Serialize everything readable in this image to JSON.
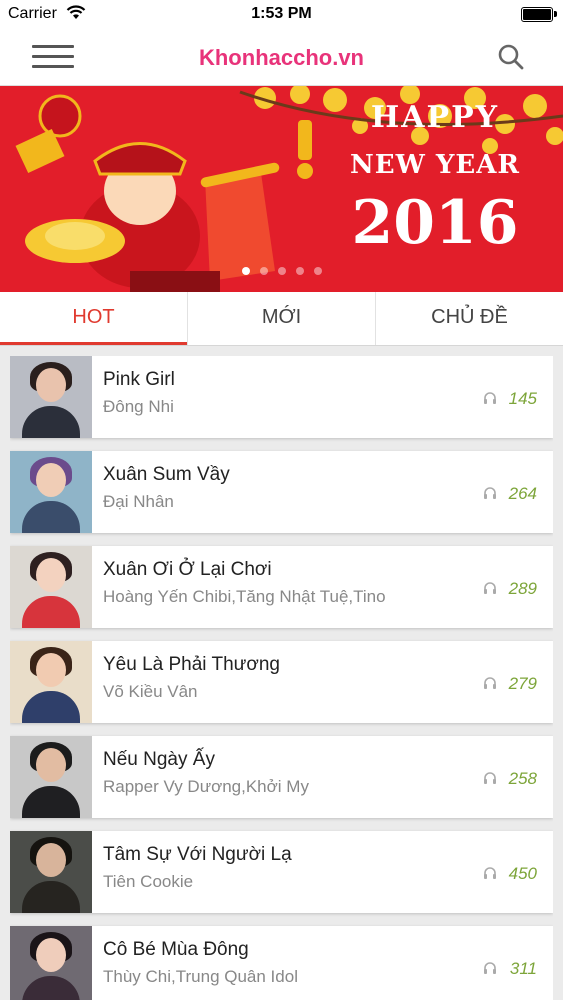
{
  "status_bar": {
    "carrier": "Carrier",
    "time": "1:53 PM"
  },
  "header": {
    "title": "Khonhaccho.vn"
  },
  "banner": {
    "line1": "HAPPY",
    "line2": "NEW YEAR",
    "line3": "2016"
  },
  "tabs": [
    {
      "label": "HOT",
      "active": true
    },
    {
      "label": "MỚI",
      "active": false
    },
    {
      "label": "CHỦ ĐỀ",
      "active": false
    }
  ],
  "songs": [
    {
      "title": "Pink Girl",
      "artist": "Đông Nhi",
      "plays": "145"
    },
    {
      "title": "Xuân Sum Vầy",
      "artist": "Đại Nhân",
      "plays": "264"
    },
    {
      "title": "Xuân Ơi Ở Lại Chơi",
      "artist": "Hoàng Yến Chibi,Tăng Nhật Tuệ,Tino",
      "plays": "289"
    },
    {
      "title": "Yêu Là Phải Thương",
      "artist": "Võ Kiều Vân",
      "plays": "279"
    },
    {
      "title": "Nếu Ngày Ấy",
      "artist": "Rapper Vy Dương,Khởi My",
      "plays": "258"
    },
    {
      "title": "Tâm Sự Với Người Lạ",
      "artist": "Tiên Cookie",
      "plays": "450"
    },
    {
      "title": "Cô Bé Mùa Đông",
      "artist": "Thùy Chi,Trung Quân Idol",
      "plays": "311"
    }
  ],
  "colors": {
    "brand": "#e8337a",
    "tab_active": "#e03a2f",
    "play_count": "#7da53a",
    "banner_red": "#e21e2a"
  }
}
